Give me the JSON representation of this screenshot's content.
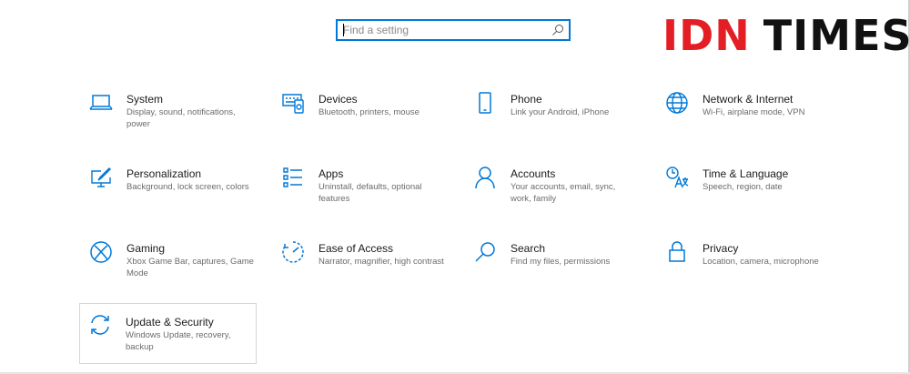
{
  "search": {
    "placeholder": "Find a setting",
    "icon": "search-icon"
  },
  "logo": {
    "part1": "IDN",
    "part2": "TIMES",
    "accent": "#e31e24"
  },
  "accent_color": "#0078d7",
  "tiles": [
    {
      "title": "System",
      "desc": "Display, sound, notifications, power",
      "icon": "laptop-icon"
    },
    {
      "title": "Devices",
      "desc": "Bluetooth, printers, mouse",
      "icon": "keyboard-icon"
    },
    {
      "title": "Phone",
      "desc": "Link your Android, iPhone",
      "icon": "phone-icon"
    },
    {
      "title": "Network & Internet",
      "desc": "Wi-Fi, airplane mode, VPN",
      "icon": "globe-icon"
    },
    {
      "title": "Personalization",
      "desc": "Background, lock screen, colors",
      "icon": "paint-monitor-icon"
    },
    {
      "title": "Apps",
      "desc": "Uninstall, defaults, optional features",
      "icon": "apps-list-icon"
    },
    {
      "title": "Accounts",
      "desc": "Your accounts, email, sync, work, family",
      "icon": "person-icon"
    },
    {
      "title": "Time & Language",
      "desc": "Speech, region, date",
      "icon": "time-language-icon"
    },
    {
      "title": "Gaming",
      "desc": "Xbox Game Bar, captures, Game Mode",
      "icon": "xbox-icon"
    },
    {
      "title": "Ease of Access",
      "desc": "Narrator, magnifier, high contrast",
      "icon": "ease-of-access-icon"
    },
    {
      "title": "Search",
      "desc": "Find my files, permissions",
      "icon": "search-icon"
    },
    {
      "title": "Privacy",
      "desc": "Location, camera, microphone",
      "icon": "lock-icon"
    },
    {
      "title": "Update & Security",
      "desc": "Windows Update, recovery, backup",
      "icon": "sync-icon",
      "selected": true
    }
  ]
}
